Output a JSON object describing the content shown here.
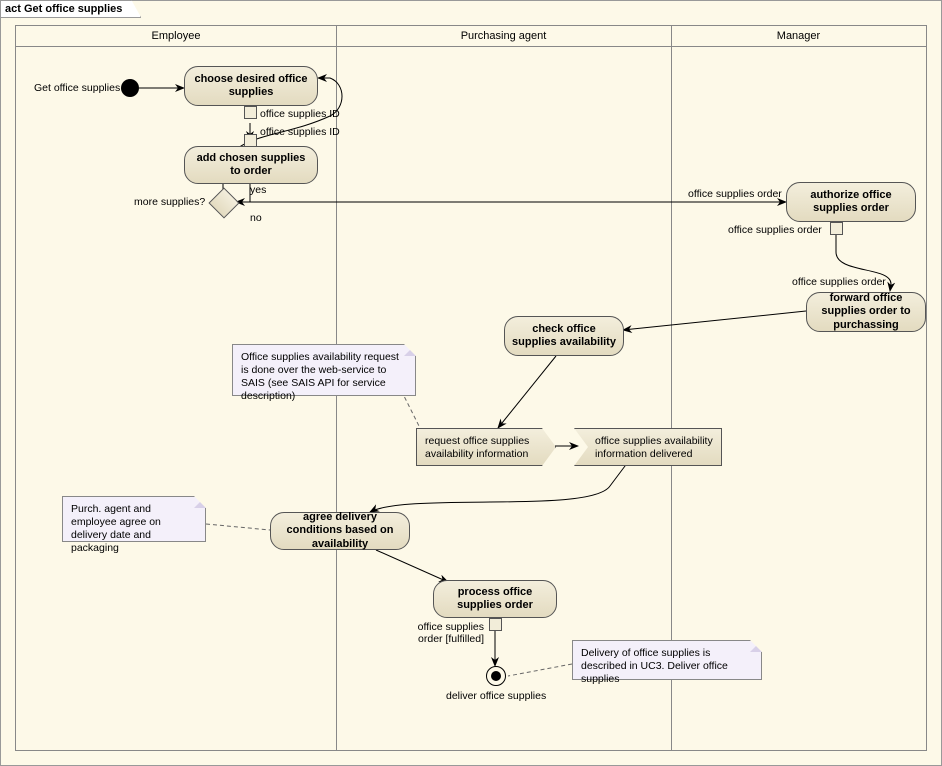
{
  "frame_title": "act Get office supplies",
  "lanes": {
    "employee": "Employee",
    "purchasing": "Purchasing agent",
    "manager": "Manager"
  },
  "activities": {
    "choose": "choose desired office supplies",
    "add": "add chosen supplies to order",
    "authorize": "authorize office supplies order",
    "forward": "forward office supplies order to purchassing",
    "check": "check office supplies availability",
    "agree": "agree delivery conditions based on availability",
    "process": "process office supplies order"
  },
  "labels": {
    "initial": "Get office supplies",
    "pin_choose_out": "office supplies ID",
    "pin_add_in": "office supplies ID",
    "decision_q": "more supplies?",
    "yes": "yes",
    "no": "no",
    "edge_to_auth": "office supplies order",
    "pin_auth_out": "office supplies order",
    "edge_to_forward": "office supplies order",
    "send_signal": "request office supplies availability information",
    "recv_signal": "office supplies availability information delivered",
    "process_out": "office supplies order [fulfilled]",
    "final": "deliver office supplies"
  },
  "notes": {
    "sais": "Office supplies availability request is done over the web-service to SAIS (see SAIS API for service description)",
    "agree": "Purch. agent and employee agree on delivery date and packaging",
    "deliver": "Delivery of office supplies is described in UC3. Deliver office supplies"
  }
}
